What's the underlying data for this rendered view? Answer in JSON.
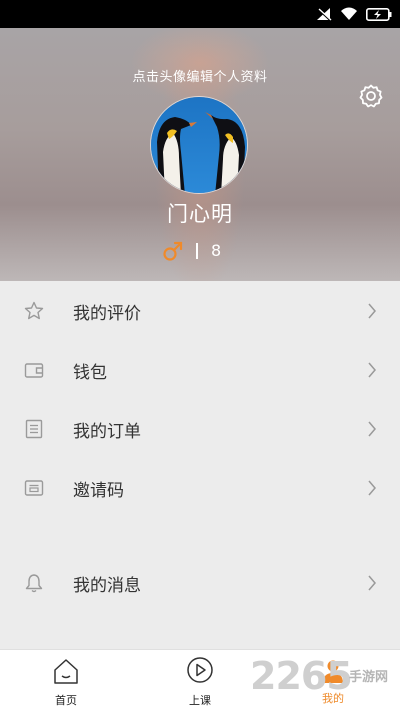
{
  "status_bar": {
    "icons": [
      "signal-muted-icon",
      "wifi-icon",
      "battery-charging-icon"
    ]
  },
  "profile": {
    "hint": "点击头像编辑个人资料",
    "username": "门心明",
    "gender_icon": "male-icon",
    "age": "8",
    "avatar": "penguin-avatar",
    "settings_icon": "gear-icon"
  },
  "menu": {
    "items": [
      {
        "label": "我的评价",
        "icon": "star-icon"
      },
      {
        "label": "钱包",
        "icon": "wallet-icon"
      },
      {
        "label": "我的订单",
        "icon": "order-list-icon"
      },
      {
        "label": "邀请码",
        "icon": "invite-code-icon"
      },
      {
        "label": "我的消息",
        "icon": "bell-icon"
      }
    ]
  },
  "bottom_nav": {
    "items": [
      {
        "label": "首页",
        "icon": "home-icon"
      },
      {
        "label": "上课",
        "icon": "play-icon"
      },
      {
        "label": "我的",
        "icon": "profile-icon"
      }
    ]
  },
  "watermark": {
    "number": "2265",
    "site": "手游网"
  },
  "colors": {
    "accent_orange": "#f08a2a",
    "menu_text": "#333333",
    "menu_icon": "#9a9a9a",
    "background": "#ececec"
  }
}
